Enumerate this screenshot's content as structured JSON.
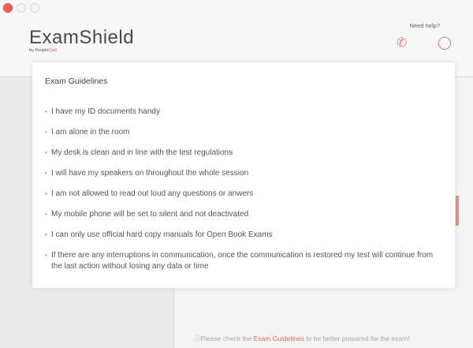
{
  "app": {
    "name": "ExamShield",
    "byline_prefix": "by People",
    "byline_accent": "Cert"
  },
  "header": {
    "help_label": "Need help?",
    "icons": [
      "phone-icon",
      "chat-icon"
    ]
  },
  "modal": {
    "title": "Exam Guidelines",
    "items": [
      "I have my ID documents handy",
      "I am alone in the room",
      "My desk is clean and in line with the test regulations",
      "I will have my speakers on throughout the whole session",
      "I am not allowed to read out loud any questions or anwers",
      "My mobile phone will be set to silent and not deactivated",
      "I can only use official hard copy manuals for Open Book Exams",
      "If there are any interruptions in communication, once the communication is restored my test will continue from the last action without losing any data or time"
    ]
  },
  "footer": {
    "note_prefix": "ⓘPlease check the ",
    "note_link": "Exam Guidelines",
    "note_suffix": " to be better prepared for the exam!"
  },
  "colors": {
    "accent": "#e44b39",
    "close_dot": "#ff5f57"
  }
}
